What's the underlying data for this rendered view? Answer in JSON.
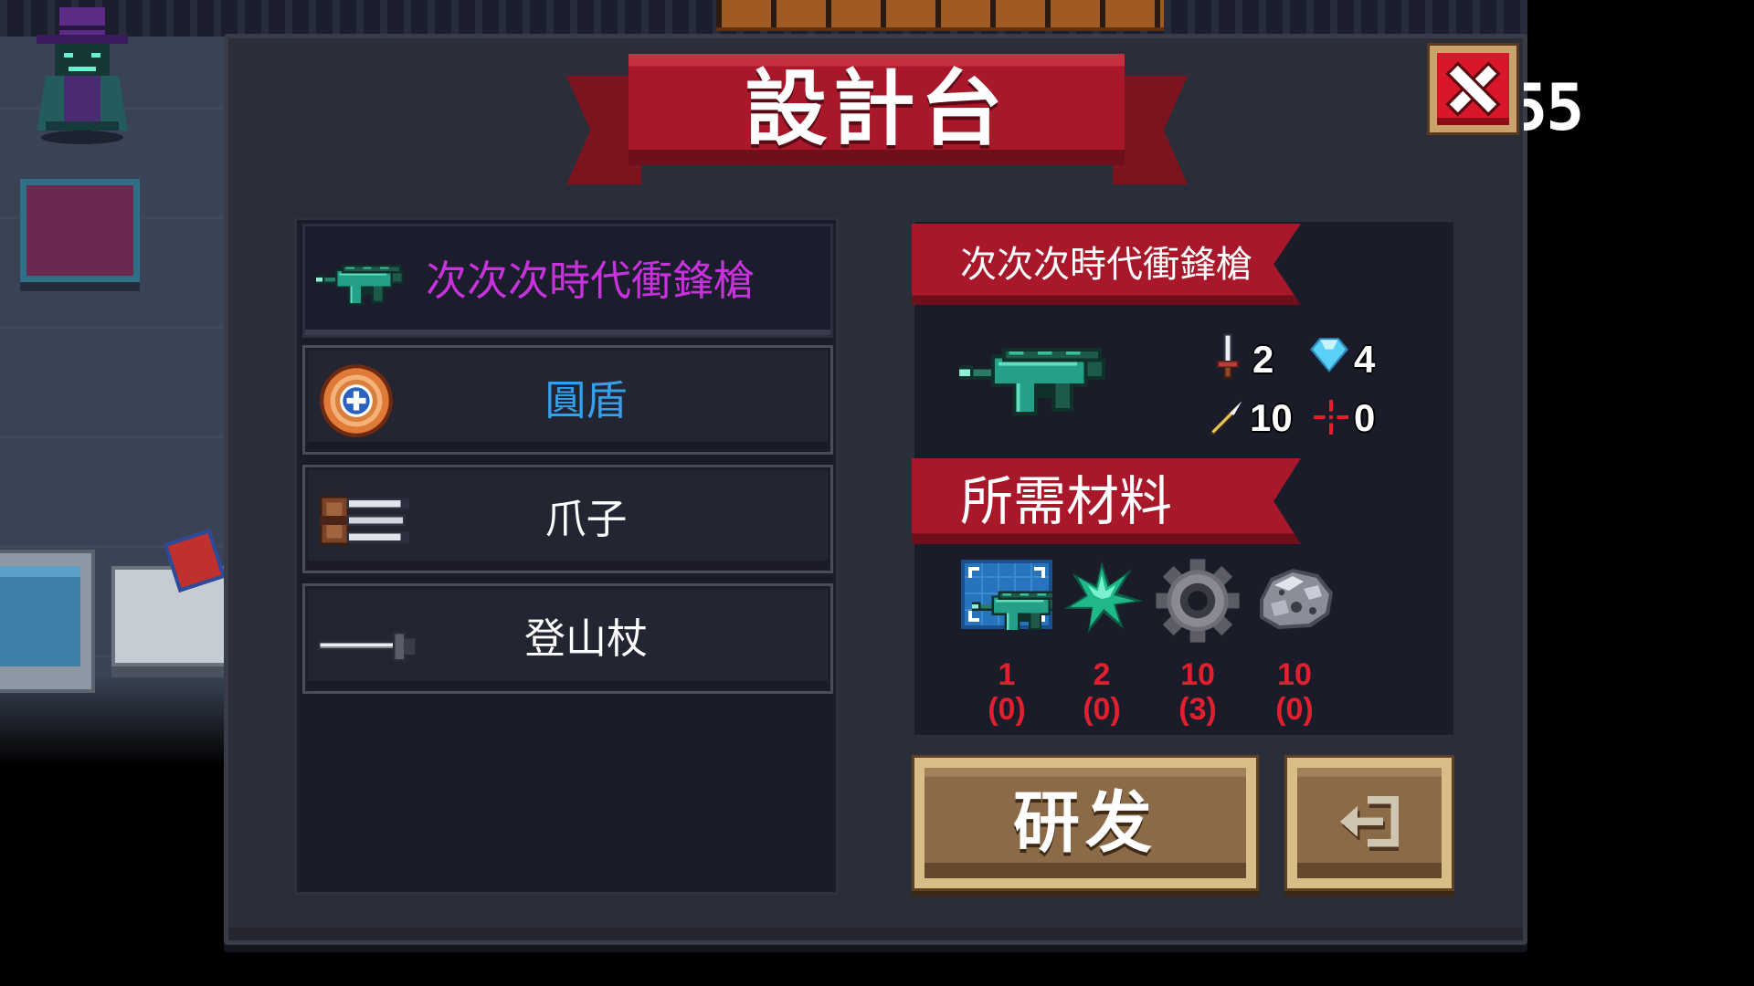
{
  "window": {
    "title": "設計台"
  },
  "hud": {
    "counter_partial": "55"
  },
  "colors": {
    "ribbon_red": "#a8182a",
    "panel_bg": "#2b2d39",
    "list_bg": "#1b1c2a",
    "material_count_red": "#e0202e",
    "button_wood": "#8b6a47",
    "button_trim": "#d9bd87"
  },
  "item_list": [
    {
      "label": "次次次時代衝鋒槍",
      "color": "#c832dc",
      "icon": "smg-icon",
      "selected": true
    },
    {
      "label": "圓盾",
      "color": "#33a0ec",
      "icon": "round-shield-icon",
      "selected": false
    },
    {
      "label": "爪子",
      "color": "#ffffff",
      "icon": "claw-icon",
      "selected": false
    },
    {
      "label": "登山杖",
      "color": "#ffffff",
      "icon": "trekking-pole-icon",
      "selected": false
    }
  ],
  "detail": {
    "name": "次次次時代衝鋒槍",
    "weapon_icon": "smg-icon",
    "stats": [
      {
        "icon": "damage-sword-icon",
        "value": "2"
      },
      {
        "icon": "energy-diamond-icon",
        "value": "4"
      },
      {
        "icon": "crit-bullet-icon",
        "value": "10"
      },
      {
        "icon": "spread-crosshair-icon",
        "value": "0"
      }
    ],
    "materials_label": "所需材料",
    "materials": [
      {
        "icon": "blueprint-icon",
        "required": "1",
        "owned": "(0)"
      },
      {
        "icon": "green-crystal-icon",
        "required": "2",
        "owned": "(0)"
      },
      {
        "icon": "gear-part-icon",
        "required": "10",
        "owned": "(3)"
      },
      {
        "icon": "iron-ore-icon",
        "required": "10",
        "owned": "(0)"
      }
    ]
  },
  "buttons": {
    "craft_label": "研发",
    "exit_icon": "exit-arrow-icon",
    "close_icon": "close-x-icon"
  }
}
